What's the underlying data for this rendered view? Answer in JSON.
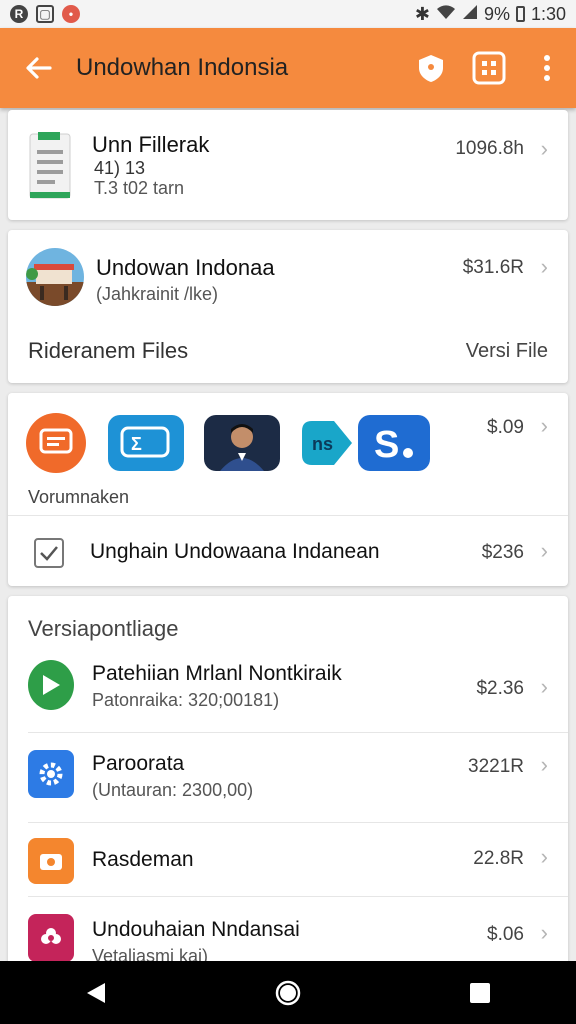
{
  "status_bar": {
    "battery": "9%",
    "time": "1:30"
  },
  "app_bar": {
    "title": "Undowhan Indonsia",
    "back_icon": "arrow-back-icon",
    "actions": [
      "shield-icon",
      "grid-icon",
      "more-vert-icon"
    ]
  },
  "file_card": {
    "title": "Unn Fillerak",
    "line1": "41) 13",
    "line2": "T.3 t02 tarn",
    "amount": "1096.8h"
  },
  "profile_card": {
    "title": "Undowan Indonaa",
    "subtitle": "(Jahkrainit /lke)",
    "amount": "$31.6R",
    "section_label": "Rideranem Files",
    "section_link": "Versi File"
  },
  "apps_card": {
    "amount": "$.09",
    "apps_label": "Vorumnaken",
    "check_item": {
      "label": "Unghain Undowaana Indanean",
      "amount": "$236"
    }
  },
  "list_card": {
    "header": "Versiapontliage",
    "items": [
      {
        "title": "Patehiian Mrlanl Nontkiraik",
        "subtitle": "Patonraika: 320;00181)",
        "amount": "$2.36",
        "icon": "play-icon",
        "color": "#2e9e48"
      },
      {
        "title": "Paroorata",
        "subtitle": "(Untauran: 2300,00)",
        "amount": "3221R",
        "icon": "settings-icon",
        "color": "#2d7be5"
      },
      {
        "title": "Rasdeman",
        "subtitle": "",
        "amount": "22.8R",
        "icon": "camera-icon",
        "color": "#f4862e"
      },
      {
        "title": "Undouhaian Nndansai",
        "subtitle": "Vetaliasmi kai)",
        "amount": "$.06",
        "icon": "flower-icon",
        "color": "#c4245a"
      }
    ]
  },
  "colors": {
    "accent": "#f58a3e",
    "nav": "#000000"
  }
}
